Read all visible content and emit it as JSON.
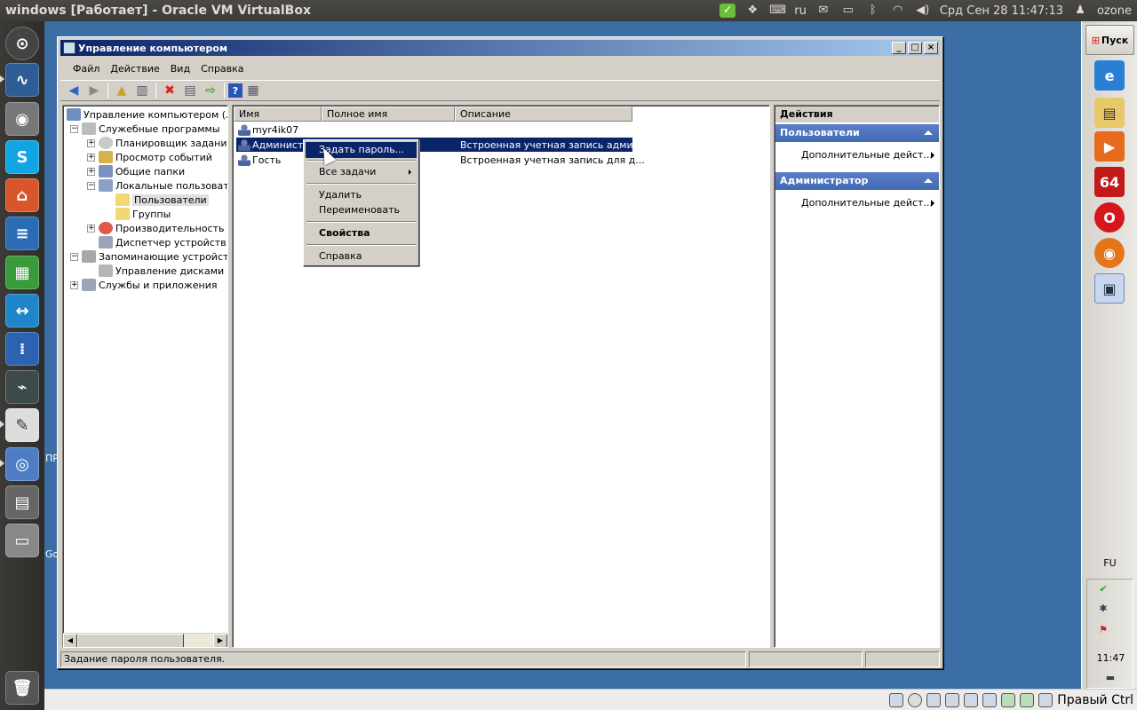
{
  "host": {
    "window_title": "windows [Работает] - Oracle VM VirtualBox",
    "keyboard_layout": "ru",
    "datetime": "Срд Сен 28 11:47:13",
    "user": "ozone",
    "host_key_label": "Правый Ctrl"
  },
  "guest": {
    "start_label": "Пуск",
    "lang_indicator": "FU",
    "clock": "11:47",
    "taskbar_badge": "64",
    "desktop_fragments": [
      "ПР",
      "Go"
    ]
  },
  "mmc": {
    "title": "Управление компьютером",
    "menu": [
      "Файл",
      "Действие",
      "Вид",
      "Справка"
    ],
    "tree": [
      {
        "label": "Управление компьютером (лока",
        "level": 0
      },
      {
        "label": "Служебные программы",
        "level": 1,
        "toggle": "−"
      },
      {
        "label": "Планировщик заданий",
        "level": 2,
        "toggle": "+"
      },
      {
        "label": "Просмотр событий",
        "level": 2,
        "toggle": "+"
      },
      {
        "label": "Общие папки",
        "level": 2,
        "toggle": "+"
      },
      {
        "label": "Локальные пользовател",
        "level": 2,
        "toggle": "−"
      },
      {
        "label": "Пользователи",
        "level": 3,
        "selected": true
      },
      {
        "label": "Группы",
        "level": 3
      },
      {
        "label": "Производительность",
        "level": 2,
        "toggle": "+"
      },
      {
        "label": "Диспетчер устройств",
        "level": 2
      },
      {
        "label": "Запоминающие устройства",
        "level": 1,
        "toggle": "−"
      },
      {
        "label": "Управление дисками",
        "level": 2
      },
      {
        "label": "Службы и приложения",
        "level": 1,
        "toggle": "+"
      }
    ],
    "columns": [
      "Имя",
      "Полное имя",
      "Описание"
    ],
    "users": [
      {
        "name": "myr4ik07",
        "full_name": "",
        "description": ""
      },
      {
        "name": "Администр",
        "full_name": "",
        "description": "Встроенная учетная запись админ..."
      },
      {
        "name": "Гость",
        "full_name": "",
        "description": "Встроенная учетная запись для д..."
      }
    ],
    "actions": {
      "header": "Действия",
      "sections": [
        {
          "title": "Пользователи",
          "item": "Дополнительные дейст..."
        },
        {
          "title": "Администратор",
          "item": "Дополнительные дейст..."
        }
      ]
    },
    "status_text": "Задание пароля пользователя.",
    "context_menu": {
      "set_password": "Задать пароль...",
      "all_tasks": "Все задачи",
      "delete": "Удалить",
      "rename": "Переименовать",
      "properties": "Свойства",
      "help": "Справка"
    }
  }
}
